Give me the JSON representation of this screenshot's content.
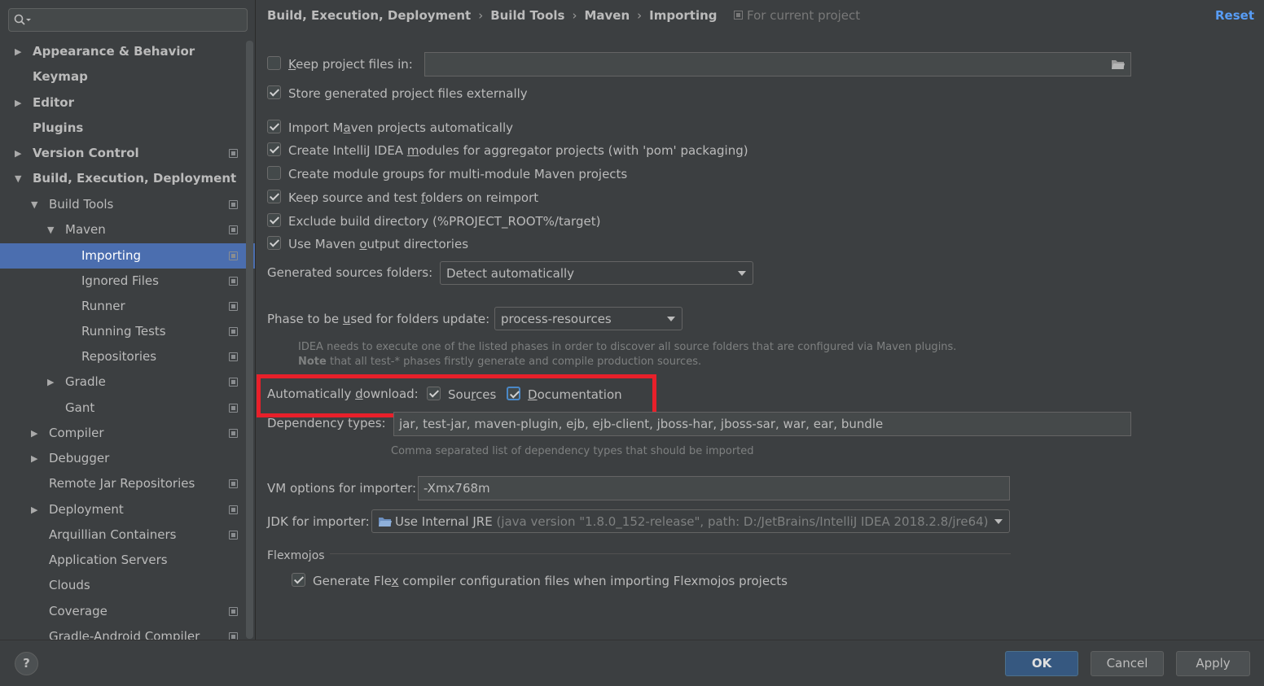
{
  "sidebar": {
    "items": [
      {
        "label": "Appearance & Behavior",
        "arrow": "▶"
      },
      {
        "label": "Keymap",
        "arrow": ""
      },
      {
        "label": "Editor",
        "arrow": "▶"
      },
      {
        "label": "Plugins",
        "arrow": ""
      },
      {
        "label": "Version Control",
        "arrow": "▶"
      },
      {
        "label": "Build, Execution, Deployment",
        "arrow": "▼"
      },
      {
        "label": "Build Tools",
        "arrow": "▼"
      },
      {
        "label": "Maven",
        "arrow": "▼"
      },
      {
        "label": "Importing",
        "arrow": ""
      },
      {
        "label": "Ignored Files",
        "arrow": ""
      },
      {
        "label": "Runner",
        "arrow": ""
      },
      {
        "label": "Running Tests",
        "arrow": ""
      },
      {
        "label": "Repositories",
        "arrow": ""
      },
      {
        "label": "Gradle",
        "arrow": "▶"
      },
      {
        "label": "Gant",
        "arrow": ""
      },
      {
        "label": "Compiler",
        "arrow": "▶"
      },
      {
        "label": "Debugger",
        "arrow": "▶"
      },
      {
        "label": "Remote Jar Repositories",
        "arrow": ""
      },
      {
        "label": "Deployment",
        "arrow": "▶"
      },
      {
        "label": "Arquillian Containers",
        "arrow": ""
      },
      {
        "label": "Application Servers",
        "arrow": ""
      },
      {
        "label": "Clouds",
        "arrow": ""
      },
      {
        "label": "Coverage",
        "arrow": ""
      },
      {
        "label": "Gradle-Android Compiler",
        "arrow": ""
      }
    ]
  },
  "header": {
    "breadcrumb": [
      "Build, Execution, Deployment",
      "Build Tools",
      "Maven",
      "Importing"
    ],
    "breadcrumb_sep": "›",
    "for_project": "For current project",
    "reset": "Reset"
  },
  "settings": {
    "keep_project_files": {
      "label_u": "K",
      "label_rest": "eep project files in:",
      "value": ""
    },
    "store_externally": "Store generated project files externally",
    "import_auto": {
      "pre": "Import M",
      "u": "a",
      "post": "ven projects automatically"
    },
    "create_modules": {
      "pre": "Create IntelliJ IDEA ",
      "u": "m",
      "post": "odules for aggregator projects (with 'pom' packaging)"
    },
    "create_groups": "Create module groups for multi-module Maven projects",
    "keep_source": {
      "pre": "Keep source and test ",
      "u": "f",
      "post": "olders on reimport"
    },
    "exclude_build": "Exclude build directory (%PROJECT_ROOT%/target)",
    "use_output": {
      "pre": "Use Maven ",
      "u": "o",
      "post": "utput directories"
    },
    "gen_sources_label": "Generated sources folders:",
    "gen_sources_value": "Detect automatically",
    "phase_label": {
      "pre": "Phase to be ",
      "u": "u",
      "post": "sed for folders update:"
    },
    "phase_value": "process-resources",
    "phase_hint_1": "IDEA needs to execute one of the listed phases in order to discover all source folders that are configured via Maven plugins.",
    "phase_hint_2_bold": "Note",
    "phase_hint_2": " that all test-* phases firstly generate and compile production sources.",
    "auto_download": {
      "pre": "Automatically ",
      "u": "d",
      "post": "ownload:"
    },
    "sources": {
      "pre": "Sou",
      "u": "r",
      "post": "ces"
    },
    "documentation": {
      "pre": "",
      "u": "D",
      "post": "ocumentation"
    },
    "dep_types_label": "Dependency types:",
    "dep_types_value": "jar, test-jar, maven-plugin, ejb, ejb-client, jboss-har, jboss-sar, war, ear, bundle",
    "dep_types_hint": "Comma separated list of dependency types that should be imported",
    "vm_label": "VM options for importer:",
    "vm_value": "-Xmx768m",
    "jdk_label": "JDK for importer:",
    "jdk_value": "Use Internal JRE",
    "jdk_detail": " (java version \"1.8.0_152-release\", path: D:/JetBrains/IntelliJ IDEA 2018.2.8/jre64)",
    "flexmojos": "Flexmojos",
    "flex_generate": {
      "pre": "Generate Fle",
      "u": "x",
      "post": " compiler configuration files when importing Flexmojos projects"
    }
  },
  "footer": {
    "help": "?",
    "ok": "OK",
    "cancel": "Cancel",
    "apply": "Apply"
  },
  "colors": {
    "selection": "#4b6eaf",
    "link": "#589df6",
    "highlight": "#e8202a",
    "primary_button": "#365880"
  }
}
